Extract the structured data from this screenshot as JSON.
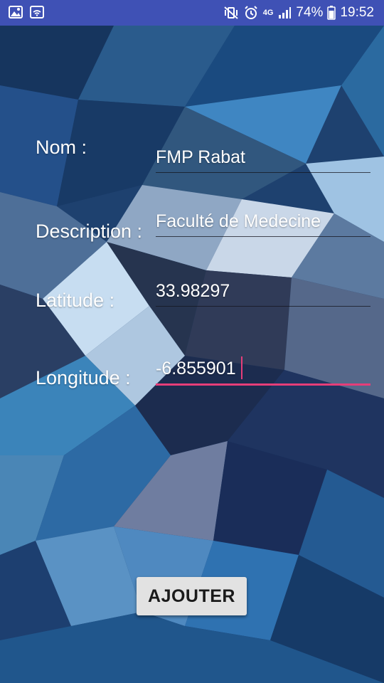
{
  "status_bar": {
    "left_icons": [
      "image-icon",
      "wifi-icon"
    ],
    "right_icons": [
      "mute-vibrate-icon",
      "alarm-icon",
      "network-4g-icon",
      "signal-icon"
    ],
    "network": "4G",
    "battery_percent": "74%",
    "battery_icon": "battery-icon",
    "time": "19:52"
  },
  "form": {
    "nom": {
      "label": "Nom :",
      "value": "FMP Rabat"
    },
    "description": {
      "label": "Description :",
      "value": "Faculté de Medecine"
    },
    "latitude": {
      "label": "Latitude :",
      "value": "33.98297"
    },
    "longitude": {
      "label": "Longitude :",
      "value": "-6.855901"
    }
  },
  "button": {
    "label": "AJOUTER"
  },
  "colors": {
    "status_bar": "#3f51b5",
    "focus_accent": "#e63e79",
    "button_bg": "#e2e2e2"
  }
}
